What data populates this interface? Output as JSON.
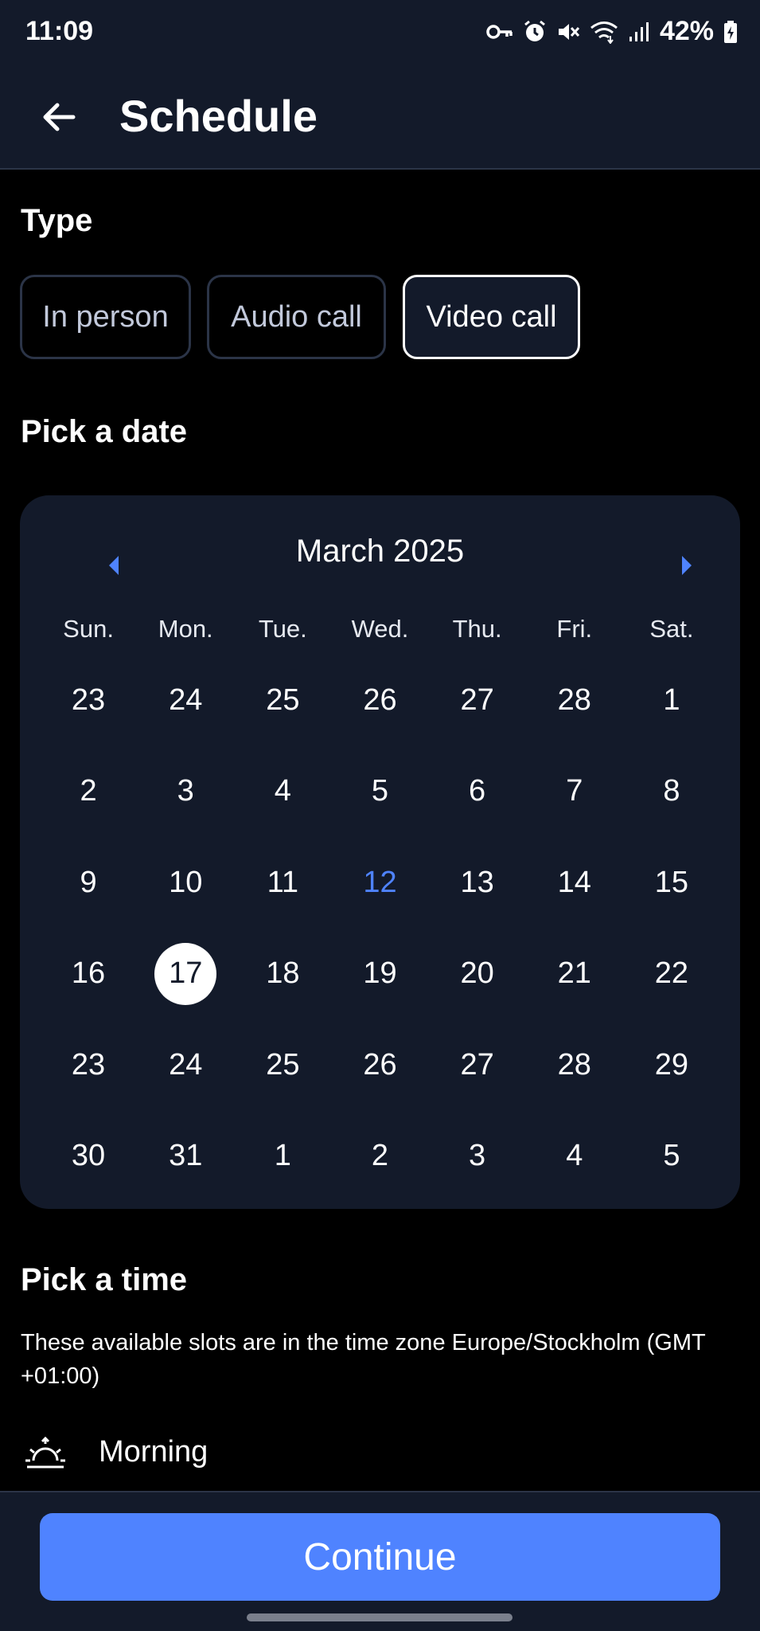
{
  "status_bar": {
    "time": "11:09",
    "battery": "42%",
    "icons": [
      "vpn-key-icon",
      "alarm-icon",
      "mute-icon",
      "wifi-icon",
      "signal-icon",
      "battery-icon"
    ]
  },
  "header": {
    "title": "Schedule",
    "back_icon": "back-arrow-icon"
  },
  "type_section": {
    "title": "Type",
    "options": [
      "In person",
      "Audio call",
      "Video call"
    ],
    "selected": "Video call"
  },
  "date_section": {
    "title": "Pick a date",
    "month_label": "March 2025",
    "weekdays": [
      "Sun.",
      "Mon.",
      "Tue.",
      "Wed.",
      "Thu.",
      "Fri.",
      "Sat."
    ],
    "days": [
      "23",
      "24",
      "25",
      "26",
      "27",
      "28",
      "1",
      "2",
      "3",
      "4",
      "5",
      "6",
      "7",
      "8",
      "9",
      "10",
      "11",
      "12",
      "13",
      "14",
      "15",
      "16",
      "17",
      "18",
      "19",
      "20",
      "21",
      "22",
      "23",
      "24",
      "25",
      "26",
      "27",
      "28",
      "29",
      "30",
      "31",
      "1",
      "2",
      "3",
      "4",
      "5"
    ],
    "today": "12",
    "selected": "17"
  },
  "time_section": {
    "title": "Pick a time",
    "description": "These available slots are in the time zone Europe/Stockholm (GMT +01:00)",
    "period": "Morning",
    "period_icon": "sunrise-icon"
  },
  "footer": {
    "continue_label": "Continue"
  },
  "colors": {
    "accent": "#4f83ff",
    "surface": "#131a2a",
    "background": "#000000"
  }
}
